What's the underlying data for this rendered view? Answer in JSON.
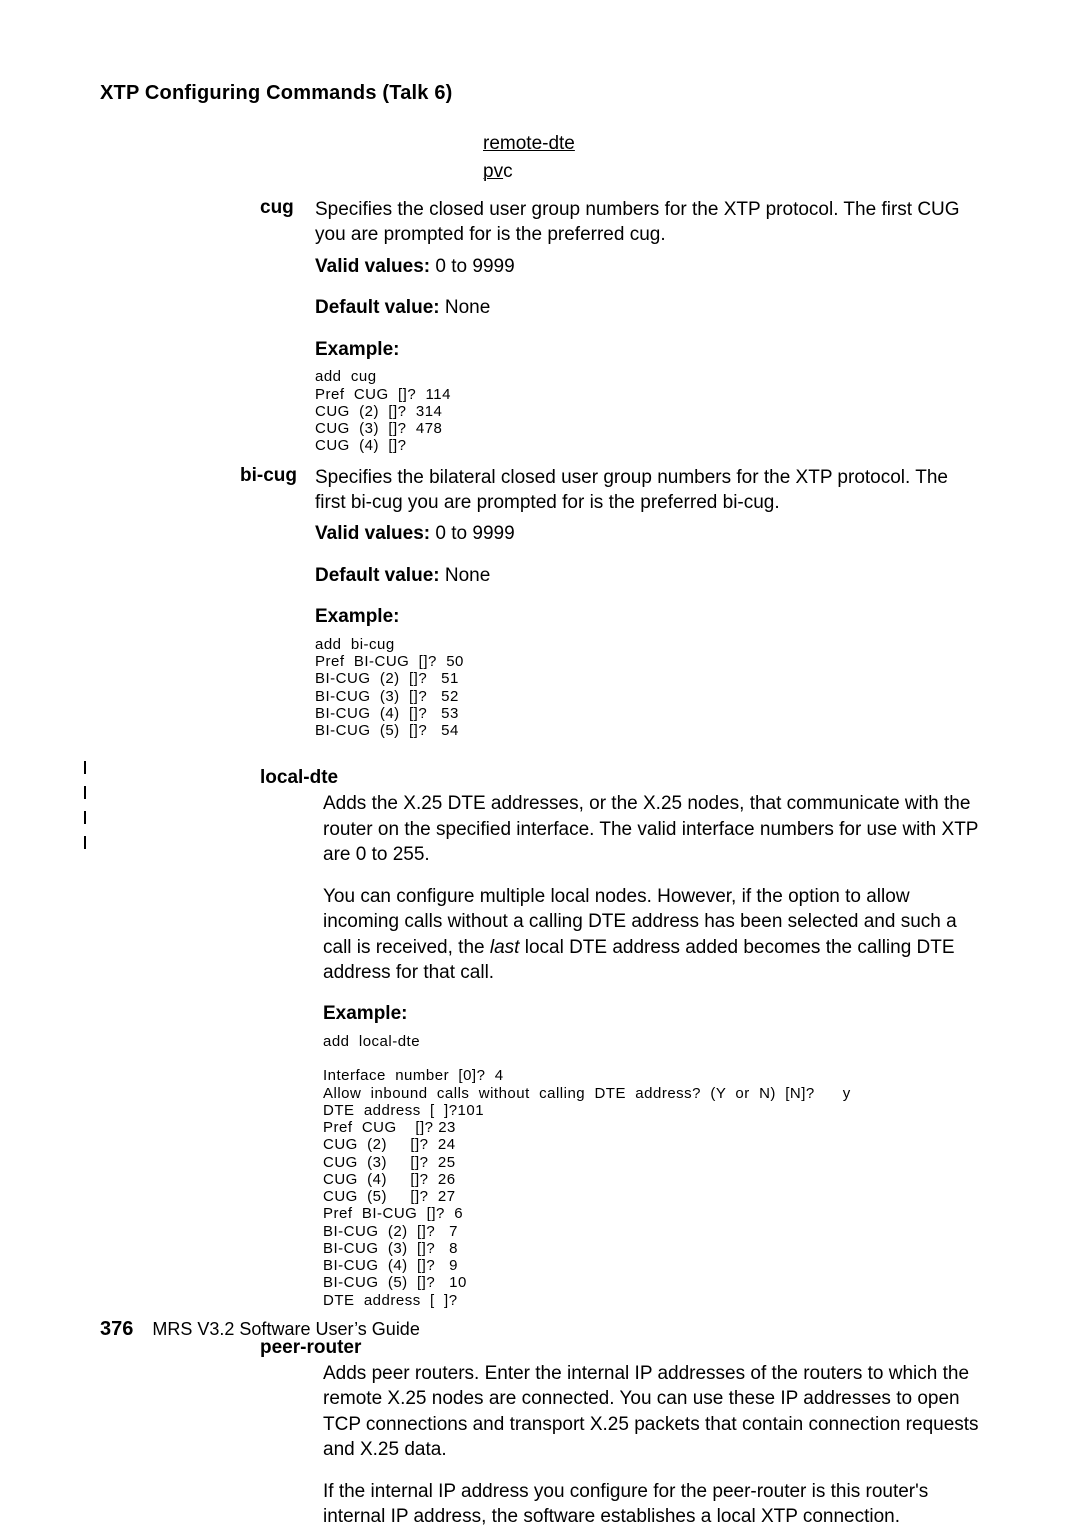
{
  "page": {
    "title": "XTP Configuring Commands (Talk 6)",
    "kw1": "remote-dte",
    "kw2_pre": "pv",
    "kw2_rest": "c"
  },
  "cug": {
    "label": "cug",
    "desc": "Specifies the closed user group numbers for the XTP protocol. The first CUG you are prompted for is the preferred cug.",
    "valid_label": "Valid values:",
    "valid_value": " 0 to 9999",
    "default_label": "Default value:",
    "default_value": " None",
    "example_label": "Example:",
    "example_text": "add  cug\nPref  CUG  []?  114\nCUG  (2)  []?  314\nCUG  (3)  []?  478\nCUG  (4)  []?"
  },
  "bicug": {
    "label": "bi-cug",
    "desc": "Specifies the bilateral closed user group numbers for the XTP protocol. The first bi-cug you are prompted for is the preferred bi-cug.",
    "valid_label": "Valid values:",
    "valid_value": " 0 to 9999",
    "default_label": "Default value:",
    "default_value": " None",
    "example_label": "Example:",
    "example_text": "add  bi-cug\nPref  BI-CUG  []?  50\nBI-CUG  (2)  []?   51\nBI-CUG  (3)  []?   52\nBI-CUG  (4)  []?   53\nBI-CUG  (5)  []?   54"
  },
  "localdte": {
    "label": "local-dte",
    "p1": "Adds the X.25 DTE addresses, or the X.25 nodes, that communicate with the router on the specified interface. The valid interface numbers for use with XTP are 0 to 255.",
    "p2a": "You can configure multiple local nodes. However, if the option to allow incoming calls without a calling DTE address has been selected and such a call is received, the ",
    "p2i": "last",
    "p2b": " local DTE address added becomes the calling DTE address for that call.",
    "example_label": "Example:",
    "example_text": "add  local-dte\n\nInterface  number  [0]?  4\nAllow  inbound  calls  without  calling  DTE  address?  (Y  or  N)  [N]?      y\nDTE  address  [  ]?101\nPref  CUG    []? 23\nCUG  (2)     []?  24\nCUG  (3)     []?  25\nCUG  (4)     []?  26\nCUG  (5)     []?  27\nPref  BI-CUG  []?  6\nBI-CUG  (2)  []?   7\nBI-CUG  (3)  []?   8\nBI-CUG  (4)  []?   9\nBI-CUG  (5)  []?   10\nDTE  address  [  ]?"
  },
  "peer": {
    "label": "peer-router",
    "p1": "Adds peer routers. Enter the internal IP addresses of the routers to which the remote X.25 nodes are connected. You can use these IP addresses to open TCP connections and transport X.25 packets that contain connection requests and X.25 data.",
    "p2": "If the internal IP address you configure for the peer-router is this router's internal IP address, the software establishes a local XTP connection."
  },
  "footer": {
    "page_number": "376",
    "book_title": "MRS V3.2 Software User’s Guide"
  }
}
